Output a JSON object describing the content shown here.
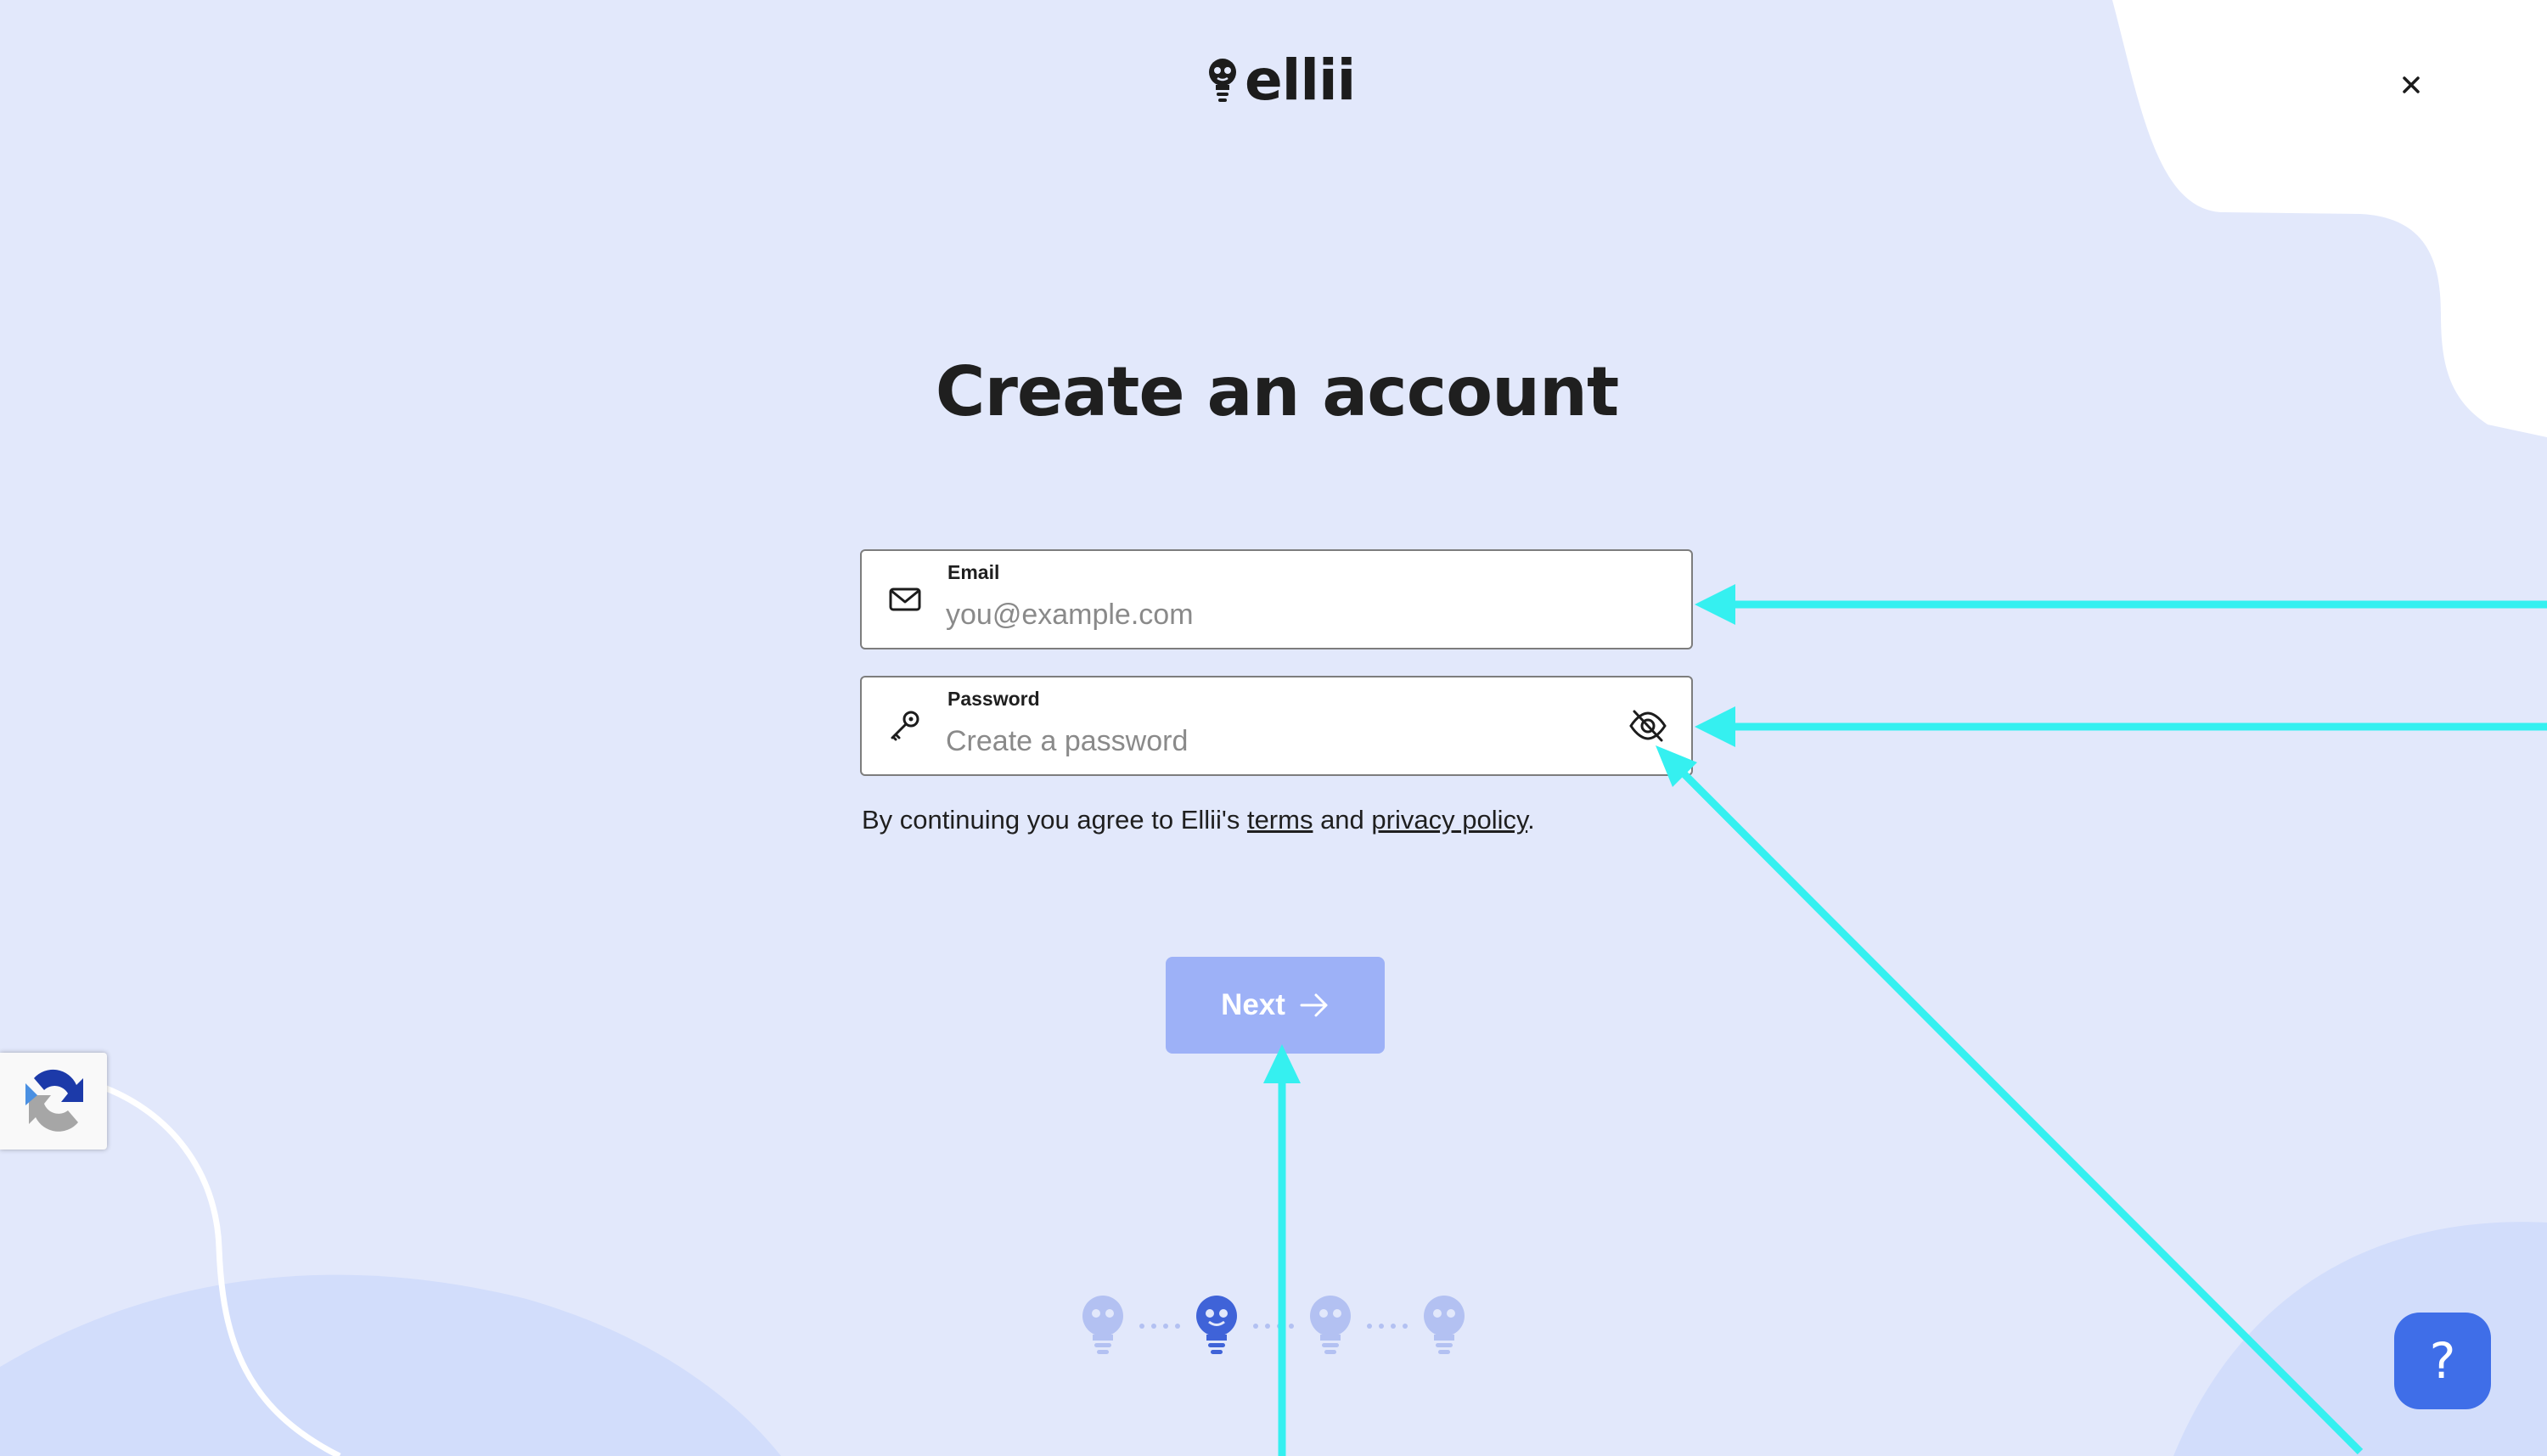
{
  "app": {
    "logo_text": "ellii"
  },
  "page": {
    "title": "Create an account"
  },
  "form": {
    "email": {
      "label": "Email",
      "placeholder": "you@example.com",
      "value": ""
    },
    "password": {
      "label": "Password",
      "placeholder": "Create a password",
      "value": ""
    },
    "consent": {
      "prefix": "By continuing you agree to Ellii's ",
      "terms_link": "terms",
      "middle": " and ",
      "privacy_link": "privacy policy",
      "suffix": "."
    },
    "next_label": "Next"
  },
  "progress": {
    "current_step": 2,
    "total_steps": 4
  },
  "help": {
    "label": "?"
  },
  "icons": {
    "close": "close-icon",
    "email": "envelope-icon",
    "password": "key-icon",
    "toggle_visibility": "eye-slash-icon",
    "next": "arrow-right-icon",
    "recaptcha": "recaptcha-icon",
    "help": "question-icon"
  },
  "colors": {
    "background": "#e2e8fb",
    "accent": "#3f6ee8",
    "next_button_disabled": "#9db1f7",
    "step_active": "#3f63d8",
    "step_inactive": "#b3c1f2",
    "annotation_arrow": "#35f0f0"
  }
}
